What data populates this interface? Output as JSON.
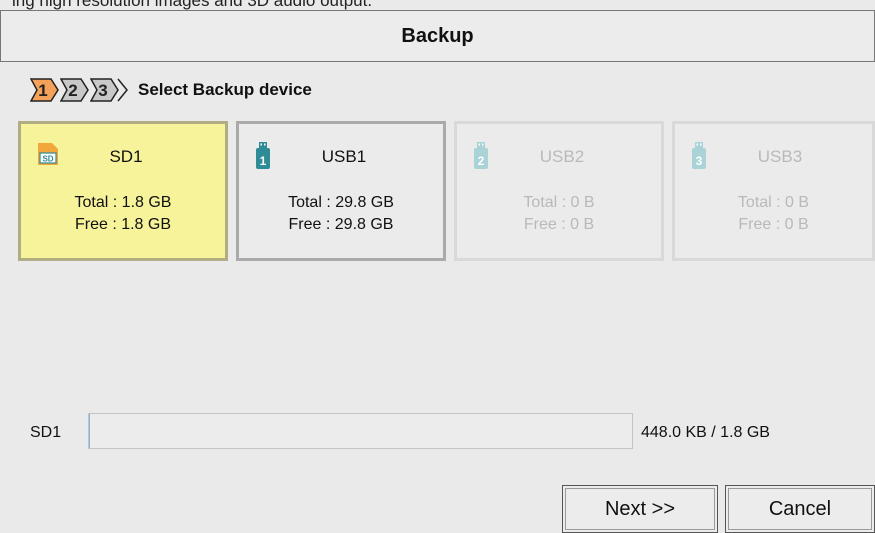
{
  "cut_text": "ing high resolution images and 3D audio output.",
  "window": {
    "title": "Backup"
  },
  "wizard": {
    "steps": [
      {
        "number": "1",
        "state": "active",
        "color": "#f4a259"
      },
      {
        "number": "2",
        "state": "pending",
        "color": "#c8c8c8"
      },
      {
        "number": "3",
        "state": "pending",
        "color": "#c8c8c8"
      }
    ],
    "label": "Select Backup device"
  },
  "devices": [
    {
      "icon": "sd-card-icon",
      "name": "SD1",
      "total": "Total : 1.8 GB",
      "free": "Free : 1.8 GB",
      "state": "selected"
    },
    {
      "icon": "usb-drive-1-icon",
      "name": "USB1",
      "total": "Total : 29.8 GB",
      "free": "Free : 29.8 GB",
      "state": "available"
    },
    {
      "icon": "usb-drive-2-icon",
      "name": "USB2",
      "total": "Total : 0 B",
      "free": "Free : 0 B",
      "state": "disabled"
    },
    {
      "icon": "usb-drive-3-icon",
      "name": "USB3",
      "total": "Total : 0 B",
      "free": "Free : 0 B",
      "state": "disabled"
    }
  ],
  "progress": {
    "label": "SD1",
    "text": "448.0 KB / 1.8 GB",
    "fraction": 0.0002
  },
  "buttons": {
    "next": "Next >>",
    "cancel": "Cancel"
  },
  "colors": {
    "selected_card": "#f6f39a",
    "usb_icon": "#2d8c95",
    "usb_icon_disabled": "#a9d3d6",
    "sd_icon": "#f2a73b",
    "sd_icon_text": "#2d8c95"
  }
}
